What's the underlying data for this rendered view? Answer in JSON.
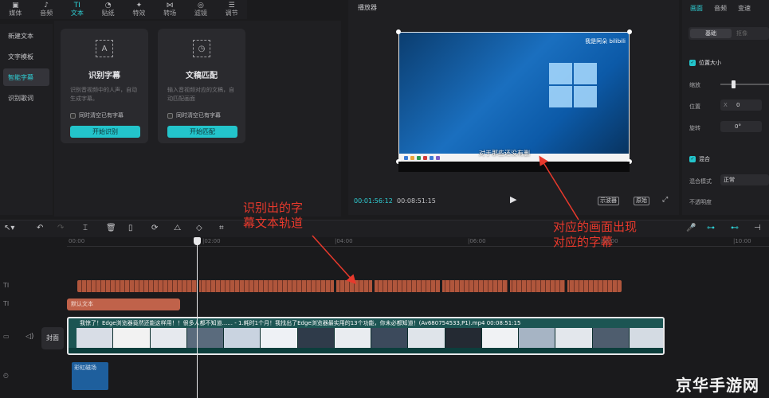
{
  "toolbar": {
    "tools": [
      {
        "icon": "media-icon",
        "glyph": "▣",
        "label": "媒体"
      },
      {
        "icon": "audio-icon",
        "glyph": "♪",
        "label": "音频"
      },
      {
        "icon": "text-icon",
        "glyph": "TI",
        "label": "文本"
      },
      {
        "icon": "sticker-icon",
        "glyph": "◔",
        "label": "贴纸"
      },
      {
        "icon": "effects-icon",
        "glyph": "✦",
        "label": "特效"
      },
      {
        "icon": "transition-icon",
        "glyph": "⋈",
        "label": "转场"
      },
      {
        "icon": "filter-icon",
        "glyph": "◎",
        "label": "滤镜"
      },
      {
        "icon": "adjust-icon",
        "glyph": "☰",
        "label": "调节"
      }
    ],
    "active_index": 2
  },
  "leftnav": {
    "items": [
      "新建文本",
      "文字模板",
      "智能字幕",
      "识别歌词"
    ],
    "active_index": 2
  },
  "cards": [
    {
      "title": "识别字幕",
      "desc": "识别音视频中的人声，自动生成字幕。",
      "check": "同时清空已有字幕",
      "button": "开始识别",
      "icon": "A"
    },
    {
      "title": "文稿匹配",
      "desc": "输入音视频对应的文稿，自动匹配画面",
      "check": "同时清空已有字幕",
      "button": "开始匹配",
      "icon": "◷"
    }
  ],
  "player": {
    "title": "播放器",
    "current_time": "00:01:56:12",
    "total_time": "00:08:51:15",
    "subtitle": "对于那些还没有删",
    "watermark": "我是阿朵 bilibili",
    "scope_btn": "示波器",
    "original_btn": "原始"
  },
  "right": {
    "tabs": [
      "画面",
      "音频",
      "变速"
    ],
    "active_tab": 0,
    "seg_on": "基础",
    "seg_off": "抠像",
    "pos_size": "位置大小",
    "scale": "缩放",
    "position": "位置",
    "pos_x_label": "X",
    "pos_x": "0",
    "rotate": "旋转",
    "rotate_val": "0°",
    "blend": "混合",
    "blend_mode": "混合模式",
    "blend_value": "正常",
    "opacity": "不透明度"
  },
  "timeline": {
    "ticks": [
      "00:00",
      "|02:00",
      "|04:00",
      "|06:00",
      "|08:00",
      "|10:00"
    ],
    "text_clip": "默认文本",
    "cover": "封面",
    "video_title": "我惊了！Edge浏览器竟然还能这样用！！很多人都不知道...... - 1.耗时1个月！我找出了Edge浏览器最实用的13个功能，你未必都知道！(Av680754533,P1).mp4    00:08:51:15",
    "audio_clip": "彩虹磁场"
  },
  "annotations": {
    "left_1": "识别出的字",
    "left_2": "幕文本轨道",
    "right_1": "对应的画面出现",
    "right_2": "对应的字幕"
  },
  "watermark": "京华手游网",
  "colors": {
    "accent": "#2fd0d6",
    "subtitle_track": "#b0563c",
    "text_clip": "#c0624a",
    "annotation": "#e8392c"
  }
}
